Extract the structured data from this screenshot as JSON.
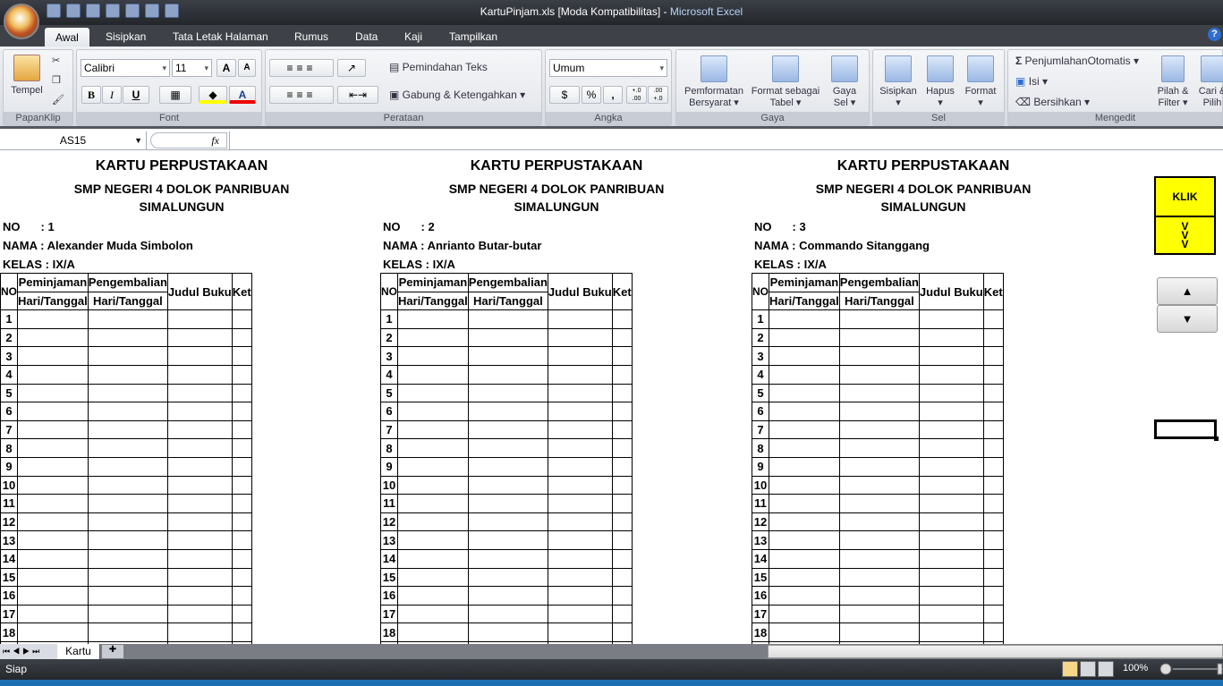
{
  "window": {
    "file": "KartuPinjam.xls  [Moda Kompatibilitas]",
    "sep": " - ",
    "app": "Microsoft Excel"
  },
  "ribbon_tabs": [
    "Awal",
    "Sisipkan",
    "Tata Letak Halaman",
    "Rumus",
    "Data",
    "Kaji",
    "Tampilkan"
  ],
  "ribbon": {
    "clipboard": {
      "paste": "Tempel",
      "label": "PapanKlip"
    },
    "font": {
      "name": "Calibri",
      "size": "11",
      "bold": "B",
      "italic": "I",
      "underline": "U",
      "label": "Font",
      "grow": "A",
      "shrink": "A",
      "color": "A"
    },
    "alignment": {
      "wrap": "Pemindahan Teks",
      "merge": "Gabung & Ketengahkan",
      "label": "Perataan"
    },
    "number": {
      "format": "Umum",
      "percent": "%",
      "comma": ",",
      "inc": "+.0 .00",
      "dec": ".00 +.0",
      "label": "Angka"
    },
    "styles": {
      "conditional": "Pemformatan Bersyarat",
      "table": "Format sebagai Tabel",
      "cell": "Gaya Sel",
      "label": "Gaya"
    },
    "cells": {
      "insert": "Sisipkan",
      "delete": "Hapus",
      "format": "Format",
      "label": "Sel"
    },
    "editing": {
      "autosum": "PenjumlahanOtomatis",
      "fill": "Isi",
      "clear": "Bersihkan",
      "sort": "Pilah & Filter",
      "find": "Cari & Pilih",
      "label": "Mengedit"
    }
  },
  "formula_bar": {
    "name_box": "AS15",
    "fx": "fx",
    "value": ""
  },
  "cards": [
    {
      "title": "KARTU PERPUSTAKAAN",
      "school": "SMP NEGERI 4 DOLOK PANRIBUAN",
      "region": "SIMALUNGUN",
      "no_label": "NO",
      "no": "1",
      "nama_label": "NAMA",
      "nama": "Alexander Muda Simbolon",
      "kelas_label": "KELAS",
      "kelas": "IX/A"
    },
    {
      "title": "KARTU PERPUSTAKAAN",
      "school": "SMP NEGERI 4 DOLOK PANRIBUAN",
      "region": "SIMALUNGUN",
      "no_label": "NO",
      "no": "2",
      "nama_label": "NAMA",
      "nama": "Anrianto Butar-butar",
      "kelas_label": "KELAS",
      "kelas": "IX/A"
    },
    {
      "title": "KARTU PERPUSTAKAAN",
      "school": "SMP NEGERI 4 DOLOK PANRIBUAN",
      "region": "SIMALUNGUN",
      "no_label": "NO",
      "no": "3",
      "nama_label": "NAMA",
      "nama": "Commando Sitanggang",
      "kelas_label": "KELAS",
      "kelas": "IX/A"
    }
  ],
  "table_headers": {
    "no": "NO",
    "borrow": "Peminjaman",
    "return": "Pengembalian",
    "date": "Hari/Tanggal",
    "title": "Judul Buku",
    "note": "Ket"
  },
  "row_numbers": [
    1,
    2,
    3,
    4,
    5,
    6,
    7,
    8,
    9,
    10,
    11,
    12,
    13,
    14,
    15,
    16,
    17,
    18
  ],
  "controls": {
    "klik": "KLIK",
    "arrows": [
      "V",
      "V",
      "V"
    ],
    "up": "▲",
    "down": "▼"
  },
  "sheet_tabs": [
    "Kartu"
  ],
  "status": {
    "ready": "Siap",
    "zoom": "100%"
  },
  "colors": {
    "klik_bg": "#ffff00"
  }
}
